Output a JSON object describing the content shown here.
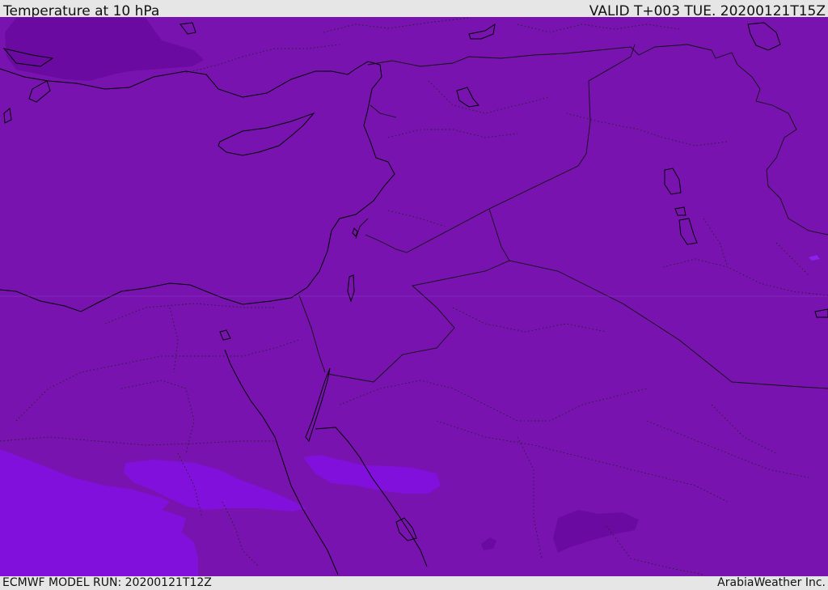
{
  "header": {
    "title": "Temperature at 10 hPa",
    "valid": "VALID T+003 TUE. 20200121T15Z"
  },
  "footer": {
    "model_run": "ECMWF MODEL RUN: 20200121T12Z",
    "credit": "ArabiaWeather Inc."
  },
  "map": {
    "field": "temperature",
    "level": "10 hPa",
    "colors": {
      "base_fill": "#7813b0",
      "warm_fill": "#6a0aa0",
      "cool_fill": "#8210dc",
      "coastline": "#000000",
      "border_line": "#1a1a1a"
    }
  }
}
